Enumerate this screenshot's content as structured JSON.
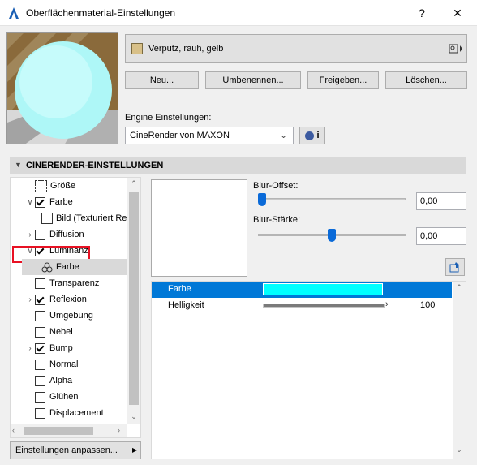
{
  "window": {
    "title": "Oberflächenmaterial-Einstellungen",
    "help": "?",
    "close": "✕"
  },
  "material": {
    "name": "Verputz, rauh, gelb",
    "swatch_color": "#d8c088"
  },
  "buttons": {
    "new": "Neu...",
    "rename": "Umbenennen...",
    "share": "Freigeben...",
    "delete": "Löschen..."
  },
  "engine": {
    "label": "Engine Einstellungen:",
    "value": "CineRender von MAXON",
    "info_icon": "i"
  },
  "section": {
    "title": "CINERENDER-EINSTELLUNGEN"
  },
  "tree": [
    {
      "label": "Größe",
      "type": "size-icon"
    },
    {
      "label": "Farbe",
      "expand": "v",
      "checked": true
    },
    {
      "label": "Bild (Texturiert Rer",
      "type": "image-icon",
      "indent": 2
    },
    {
      "label": "Diffusion",
      "expand": ">",
      "checked": false
    },
    {
      "label": "Luminanz",
      "expand": "v",
      "checked": true,
      "highlighted": true
    },
    {
      "label": "Farbe",
      "type": "color-icon",
      "indent": 2,
      "selected": true
    },
    {
      "label": "Transparenz",
      "checked": false
    },
    {
      "label": "Reflexion",
      "expand": ">",
      "checked": true
    },
    {
      "label": "Umgebung",
      "checked": false
    },
    {
      "label": "Nebel",
      "checked": false
    },
    {
      "label": "Bump",
      "expand": ">",
      "checked": true
    },
    {
      "label": "Normal",
      "checked": false
    },
    {
      "label": "Alpha",
      "checked": false
    },
    {
      "label": "Glühen",
      "checked": false
    },
    {
      "label": "Displacement",
      "checked": false
    }
  ],
  "customize": {
    "label": "Einstellungen anpassen..."
  },
  "blur_offset": {
    "label": "Blur-Offset:",
    "value": "0,00",
    "level": 0.0
  },
  "blur_strength": {
    "label": "Blur-Stärke:",
    "value": "0,00",
    "level": 0.5
  },
  "properties": [
    {
      "label": "Farbe",
      "color": "#00ffff",
      "selected": true
    },
    {
      "label": "Helligkeit",
      "value": "100",
      "level": 1.0
    }
  ],
  "colors": {
    "accent": "#0078d7",
    "highlight_border": "#e81123",
    "luminance": "#00ffff"
  }
}
